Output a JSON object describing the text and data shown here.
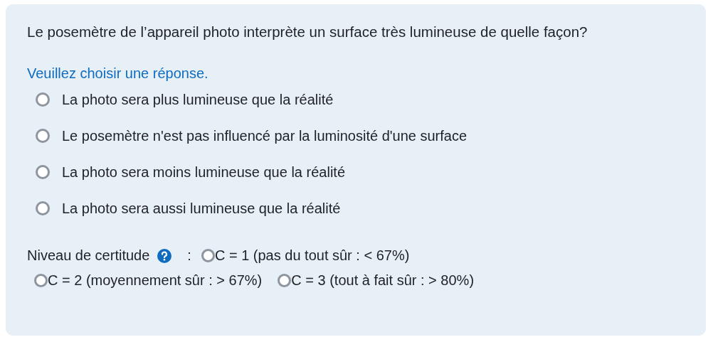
{
  "question": "Le posemètre de l’appareil photo interprète un surface très lumineuse de quelle façon?",
  "prompt": "Veuillez choisir une réponse.",
  "options": [
    {
      "label": "La photo sera plus lumineuse que la réalité",
      "selected": false
    },
    {
      "label": "Le posemètre n'est pas influencé par la luminosité d'une surface",
      "selected": false
    },
    {
      "label": "La photo sera moins lumineuse que la réalité",
      "selected": false
    },
    {
      "label": "La photo sera aussi lumineuse que la réalité",
      "selected": false
    }
  ],
  "certainty": {
    "label": "Niveau de certitude",
    "separator": ":",
    "options": [
      {
        "label": "C = 1 (pas du tout sûr : < 67%)",
        "selected": false
      },
      {
        "label": "C = 2 (moyennement sûr : > 67%)",
        "selected": false
      },
      {
        "label": "C = 3 (tout à fait sûr : > 80%)",
        "selected": false
      }
    ]
  }
}
